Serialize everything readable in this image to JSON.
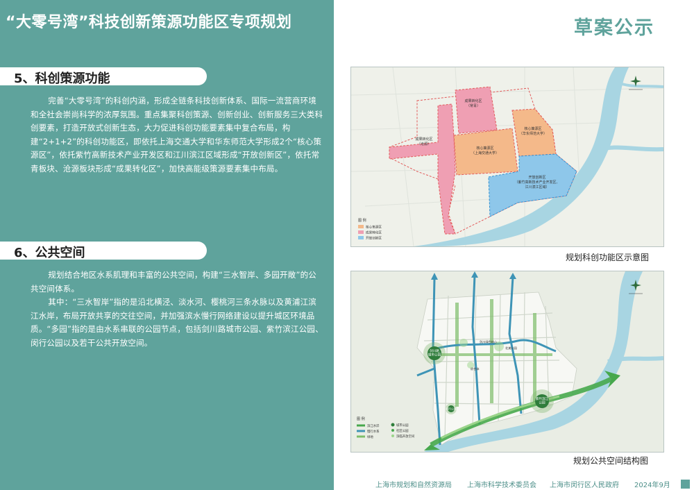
{
  "header": {
    "title": "“大零号湾”科技创新策源功能区专项规划",
    "stage": "草案公示"
  },
  "section5": {
    "heading": "5、科创策源功能",
    "paragraph": "完善“大零号湾”的科创内涵，形成全链条科技创新体系、国际一流营商环境和全社会崇尚科学的浓厚氛围。重点集聚科创策源、创新创业、创新服务三大类科创要素，打造开放式创新生态，大力促进科创功能要素集中复合布局，构建“2+1+2”的科创功能区，即依托上海交通大学和华东师范大学形成2个“核心策源区”，依托紫竹高新技术产业开发区和江川滨江区域形成“开放创新区”，依托常青板块、沧源板块形成“成果转化区”，加快高能级策源要素集中布局。"
  },
  "section6": {
    "heading": "6、公共空间",
    "paragraph1": "规划结合地区水系肌理和丰富的公共空间，构建“三水智岸、多园开敞”的公共空间体系。",
    "paragraph2": "其中：“三水智岸”指的是沿北横泾、淡水河、樱桃河三条水脉以及黄浦江滨江水岸，布局开放共享的交往空间，并加强滨水慢行网络建设以提升城区环境品质。“多园”指的是由水系串联的公园节点，包括剑川路城市公园、紫竹滨江公园、闵行公园以及若干公共开放空间。"
  },
  "map1": {
    "caption": "规划科创功能区示意图",
    "zones": {
      "chengguo_top": "成果转化区\n（常青）",
      "chengguo_left": "成果转化区\n（沧源）",
      "core_sjtu": "核心策源区\n（上海交通大学）",
      "core_ecnu": "核心策源区\n（华东师范大学）",
      "open": "开放创新区\n（紫竹高新技术产业开发区、\n江川滨江区域）"
    },
    "legend": {
      "title": "图 例",
      "items": [
        "核心策源区",
        "成果转化区",
        "开放创新区"
      ]
    },
    "colors": {
      "core": "#f4b98a",
      "chengguo": "#ef9fb3",
      "open": "#8ec7ea",
      "river": "#9fd0df"
    }
  },
  "map2": {
    "caption": "规划公共空间结构图",
    "labels": {
      "park_jianchuan": "剑川路\n城市公园",
      "park_zizhu": "紫竹滨江\n公园",
      "park_minhang": "闵行公园",
      "node1": "剑川绿色核心",
      "node2": "北美公园",
      "node3": "综合体"
    },
    "legend": {
      "title": "图 例",
      "items": [
        "滨江水岸",
        "城市公园",
        "慢行水系",
        "社区公园",
        "绿地",
        "滨临开放空间"
      ]
    },
    "colors": {
      "water": "#3e94b6",
      "green": "#47a84d",
      "park": "#2f7d3b"
    }
  },
  "footer": {
    "org1": "上海市规划和自然资源局",
    "org2": "上海市科学技术委员会",
    "org3": "上海市闵行区人民政府",
    "date": "2024年9月"
  }
}
